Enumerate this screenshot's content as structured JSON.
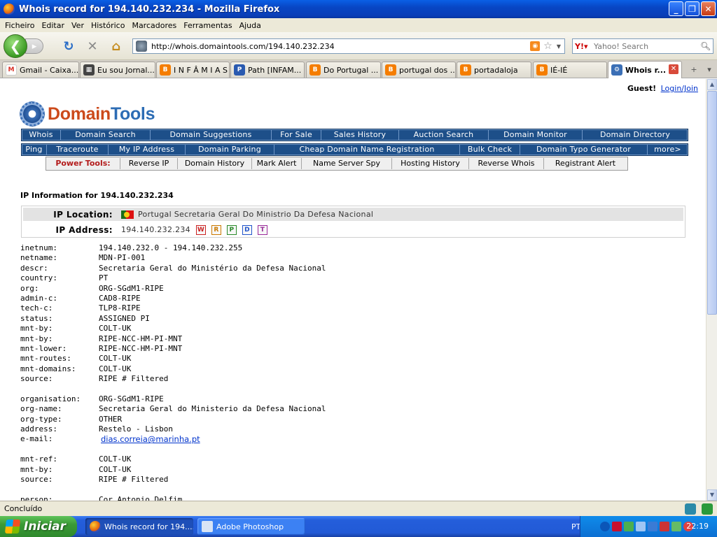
{
  "window": {
    "title": "Whois record for 194.140.232.234 - Mozilla Firefox"
  },
  "menu": [
    "Ficheiro",
    "Editar",
    "Ver",
    "Histórico",
    "Marcadores",
    "Ferramentas",
    "Ajuda"
  ],
  "nav": {
    "url": "http://whois.domaintools.com/194.140.232.234",
    "search_placeholder": "Yahoo! Search"
  },
  "tabs": [
    {
      "label": "Gmail - Caixa...",
      "icon": "gmail-icon",
      "color": "#d93025",
      "glyph": "M"
    },
    {
      "label": "Eu sou Jornal...",
      "icon": "film-icon",
      "color": "#444444",
      "glyph": "▦"
    },
    {
      "label": "I N F Â M I A S",
      "icon": "blogger-icon",
      "color": "#f57d00",
      "glyph": "B"
    },
    {
      "label": "Path [INFAM...",
      "icon": "path-icon",
      "color": "#2a5ab0",
      "glyph": "P"
    },
    {
      "label": "Do Portugal ...",
      "icon": "blogger-icon",
      "color": "#f57d00",
      "glyph": "B"
    },
    {
      "label": "portugal dos ...",
      "icon": "blogger-icon",
      "color": "#f57d00",
      "glyph": "B"
    },
    {
      "label": "portadaloja",
      "icon": "blogger-icon",
      "color": "#f57d00",
      "glyph": "B"
    },
    {
      "label": "IÉ-IÉ",
      "icon": "blogger-icon",
      "color": "#f57d00",
      "glyph": "B"
    },
    {
      "label": "Whois r...",
      "icon": "domaintools-icon",
      "color": "#3b6fb6",
      "glyph": "⚙"
    }
  ],
  "page": {
    "guest_label": "Guest!",
    "login_link": "Login/Join",
    "brand_part1": "Domain",
    "brand_part2": "Tools",
    "nav_row1": [
      "Whois",
      "Domain Search",
      "Domain Suggestions",
      "For Sale",
      "Sales History",
      "Auction Search",
      "Domain Monitor",
      "Domain Directory"
    ],
    "nav_row2": [
      "Ping",
      "Traceroute",
      "My IP Address",
      "Domain Parking",
      "Cheap Domain Name Registration",
      "Bulk Check",
      "Domain Typo Generator",
      "more>"
    ],
    "power_tools_label": "Power Tools:",
    "power_tools": [
      "Reverse IP",
      "Domain History",
      "Mark Alert",
      "Name Server Spy",
      "Hosting History",
      "Reverse Whois",
      "Registrant Alert"
    ],
    "ip_info_title": "IP Information for 194.140.232.234",
    "ip_location_label": "IP Location:",
    "ip_location_value": "Portugal Secretaria Geral Do Ministrio Da Defesa Nacional",
    "ip_address_label": "IP Address:",
    "ip_address_value": "194.140.232.234",
    "badges": [
      {
        "letter": "W",
        "color": "#cc2222"
      },
      {
        "letter": "R",
        "color": "#cc7a00"
      },
      {
        "letter": "P",
        "color": "#2a8a2a"
      },
      {
        "letter": "D",
        "color": "#2255cc"
      },
      {
        "letter": "T",
        "color": "#9a2a9a"
      }
    ],
    "whois_block1": [
      [
        "inetnum:",
        "194.140.232.0 - 194.140.232.255"
      ],
      [
        "netname:",
        "MDN-PI-001"
      ],
      [
        "descr:",
        "Secretaria Geral do Ministério da Defesa Nacional"
      ],
      [
        "country:",
        "PT"
      ],
      [
        "org:",
        "ORG-SGdM1-RIPE"
      ],
      [
        "admin-c:",
        "CAD8-RIPE"
      ],
      [
        "tech-c:",
        "TLP8-RIPE"
      ],
      [
        "status:",
        "ASSIGNED PI"
      ],
      [
        "mnt-by:",
        "COLT-UK"
      ],
      [
        "mnt-by:",
        "RIPE-NCC-HM-PI-MNT"
      ],
      [
        "mnt-lower:",
        "RIPE-NCC-HM-PI-MNT"
      ],
      [
        "mnt-routes:",
        "COLT-UK"
      ],
      [
        "mnt-domains:",
        "COLT-UK"
      ],
      [
        "source:",
        "RIPE # Filtered"
      ]
    ],
    "whois_block2": [
      [
        "organisation:",
        "ORG-SGdM1-RIPE"
      ],
      [
        "org-name:",
        "Secretaria Geral do Ministerio da Defesa Nacional"
      ],
      [
        "org-type:",
        "OTHER"
      ],
      [
        "address:",
        "Restelo - Lisbon"
      ],
      [
        "e-mail:",
        "dias.correia@marinha.pt"
      ]
    ],
    "whois_block3": [
      [
        "mnt-ref:",
        "COLT-UK"
      ],
      [
        "mnt-by:",
        "COLT-UK"
      ],
      [
        "source:",
        "RIPE # Filtered"
      ]
    ],
    "whois_block4": [
      [
        "person:",
        "Cor Antonio Delfim"
      ]
    ]
  },
  "status": {
    "text": "Concluído"
  },
  "taskbar": {
    "start_label": "Iniciar",
    "tasks": [
      {
        "label": "Whois record for 194....",
        "active": true
      },
      {
        "label": "Adobe Photoshop",
        "active": false
      }
    ],
    "lang": "PT",
    "clock": "22:19"
  }
}
